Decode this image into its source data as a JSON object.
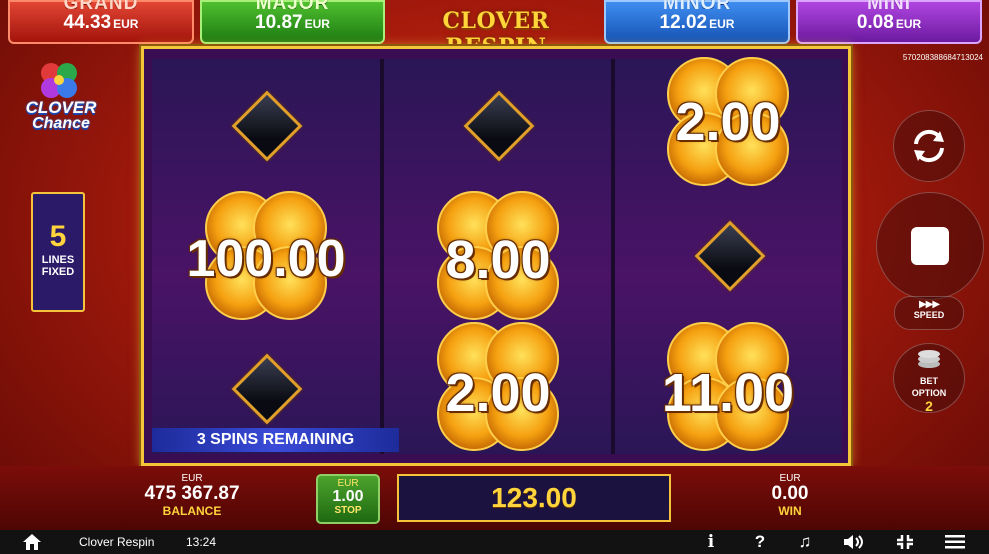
{
  "jackpots": [
    {
      "name": "GRAND",
      "amount": "44.33",
      "currency": "EUR"
    },
    {
      "name": "MAJOR",
      "amount": "10.87",
      "currency": "EUR"
    },
    {
      "name": "MINOR",
      "amount": "12.02",
      "currency": "EUR"
    },
    {
      "name": "MINI",
      "amount": "0.08",
      "currency": "EUR"
    }
  ],
  "game_title": "CLOVER RESPIN",
  "ticket_id": "570208388684713024",
  "logo": {
    "line1": "CLOVER",
    "line2": "Chance"
  },
  "lines": {
    "count": "5",
    "label1": "LINES",
    "label2": "FIXED"
  },
  "reels": {
    "reel1": {
      "top": "diamond",
      "middle": "100.00",
      "bottom": "diamond"
    },
    "reel2": {
      "top": "diamond",
      "middle": "8.00",
      "bottom": "2.00"
    },
    "reel3": {
      "top": "2.00",
      "middle": "diamond",
      "bottom": "11.00"
    }
  },
  "spins_remaining": "3 SPINS REMAINING",
  "controls": {
    "speed_label": "SPEED",
    "bet_option_label1": "BET",
    "bet_option_label2": "OPTION",
    "bet_option_value": "2"
  },
  "bottom": {
    "balance_currency": "EUR",
    "balance_amount": "475 367.87",
    "balance_label": "BALANCE",
    "bet_currency": "EUR",
    "bet_amount": "1.00",
    "bet_stop_label": "STOP",
    "win_display": "123.00",
    "win_currency": "EUR",
    "win_amount": "0.00",
    "win_label": "WIN"
  },
  "statusbar": {
    "game_name": "Clover Respin",
    "time": "13:24"
  },
  "colors": {
    "accent_gold": "#f5c43a",
    "grand": "#c0261a",
    "major": "#2f9a1c",
    "minor": "#2a6ed8",
    "mini": "#8c2ac4"
  }
}
